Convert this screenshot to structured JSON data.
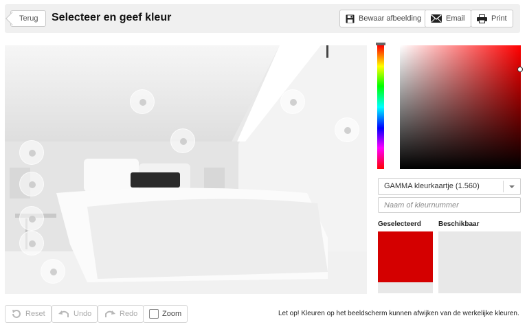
{
  "header": {
    "back_label": "Terug",
    "title": "Selecteer en geef kleur",
    "save_label": "Bewaar afbeelding",
    "email_label": "Email",
    "print_label": "Print"
  },
  "picker": {
    "hue_color": "#ff0000",
    "collection_select": "GAMMA kleurkaartje (1.560)",
    "search_placeholder": "Naam of kleurnummer",
    "selected_label": "Geselecteerd",
    "available_label": "Beschikbaar",
    "selected_color": "#d40000"
  },
  "toolbar": {
    "reset_label": "Reset",
    "undo_label": "Undo",
    "redo_label": "Redo",
    "zoom_label": "Zoom"
  },
  "notice": "Let op! Kleuren op het beeldscherm kunnen afwijken van de werkelijke kleuren."
}
